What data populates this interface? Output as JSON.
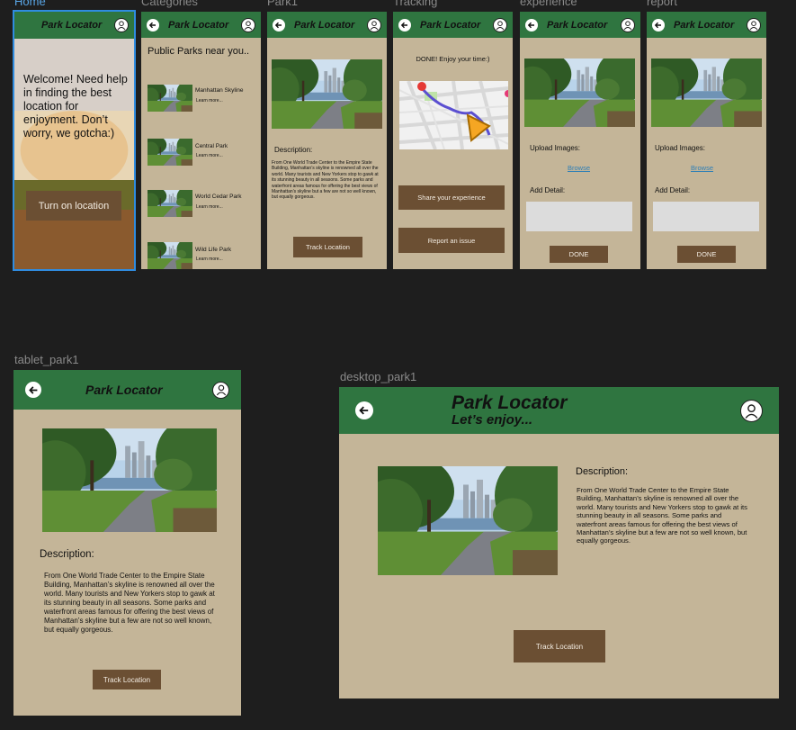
{
  "app_title": "Park Locator",
  "labels": {
    "home": "Home",
    "categories": "Categories",
    "park1": "Park1",
    "tracking": "Tracking",
    "experience": "experience",
    "report": "report",
    "tablet": "tablet_park1",
    "desktop": "desktop_park1"
  },
  "home": {
    "welcome": "Welcome! Need help in finding the best location for enjoyment. Don’t worry, we gotcha:)",
    "button": "Turn on location"
  },
  "categories": {
    "heading": "Public Parks near you..",
    "learn_more": "Learn more...",
    "items": [
      {
        "name": "Manhattan Skyline"
      },
      {
        "name": "Central Park"
      },
      {
        "name": "World Cedar Park"
      },
      {
        "name": "Wild Life Park"
      }
    ]
  },
  "park": {
    "description_label": "Description:",
    "description": "From One World Trade Center to the Empire State Building, Manhattan’s skyline is renowned all over the world. Many tourists and New Yorkers stop to gawk at its stunning beauty in all seasons. Some parks and waterfront areas famous for offering the best views of Manhattan’s skyline but a few are not so well known, but equally gorgeous.",
    "track_button": "Track Location"
  },
  "tracking": {
    "done_text": "DONE! Enjoy your time:)",
    "share_button": "Share your experience",
    "report_button": "Report an issue"
  },
  "upload": {
    "upload_label": "Upload Images:",
    "browse": "Browse",
    "detail_label": "Add Detail:",
    "done_button": "DONE"
  },
  "desktop": {
    "subtitle": "Let’s enjoy..."
  }
}
